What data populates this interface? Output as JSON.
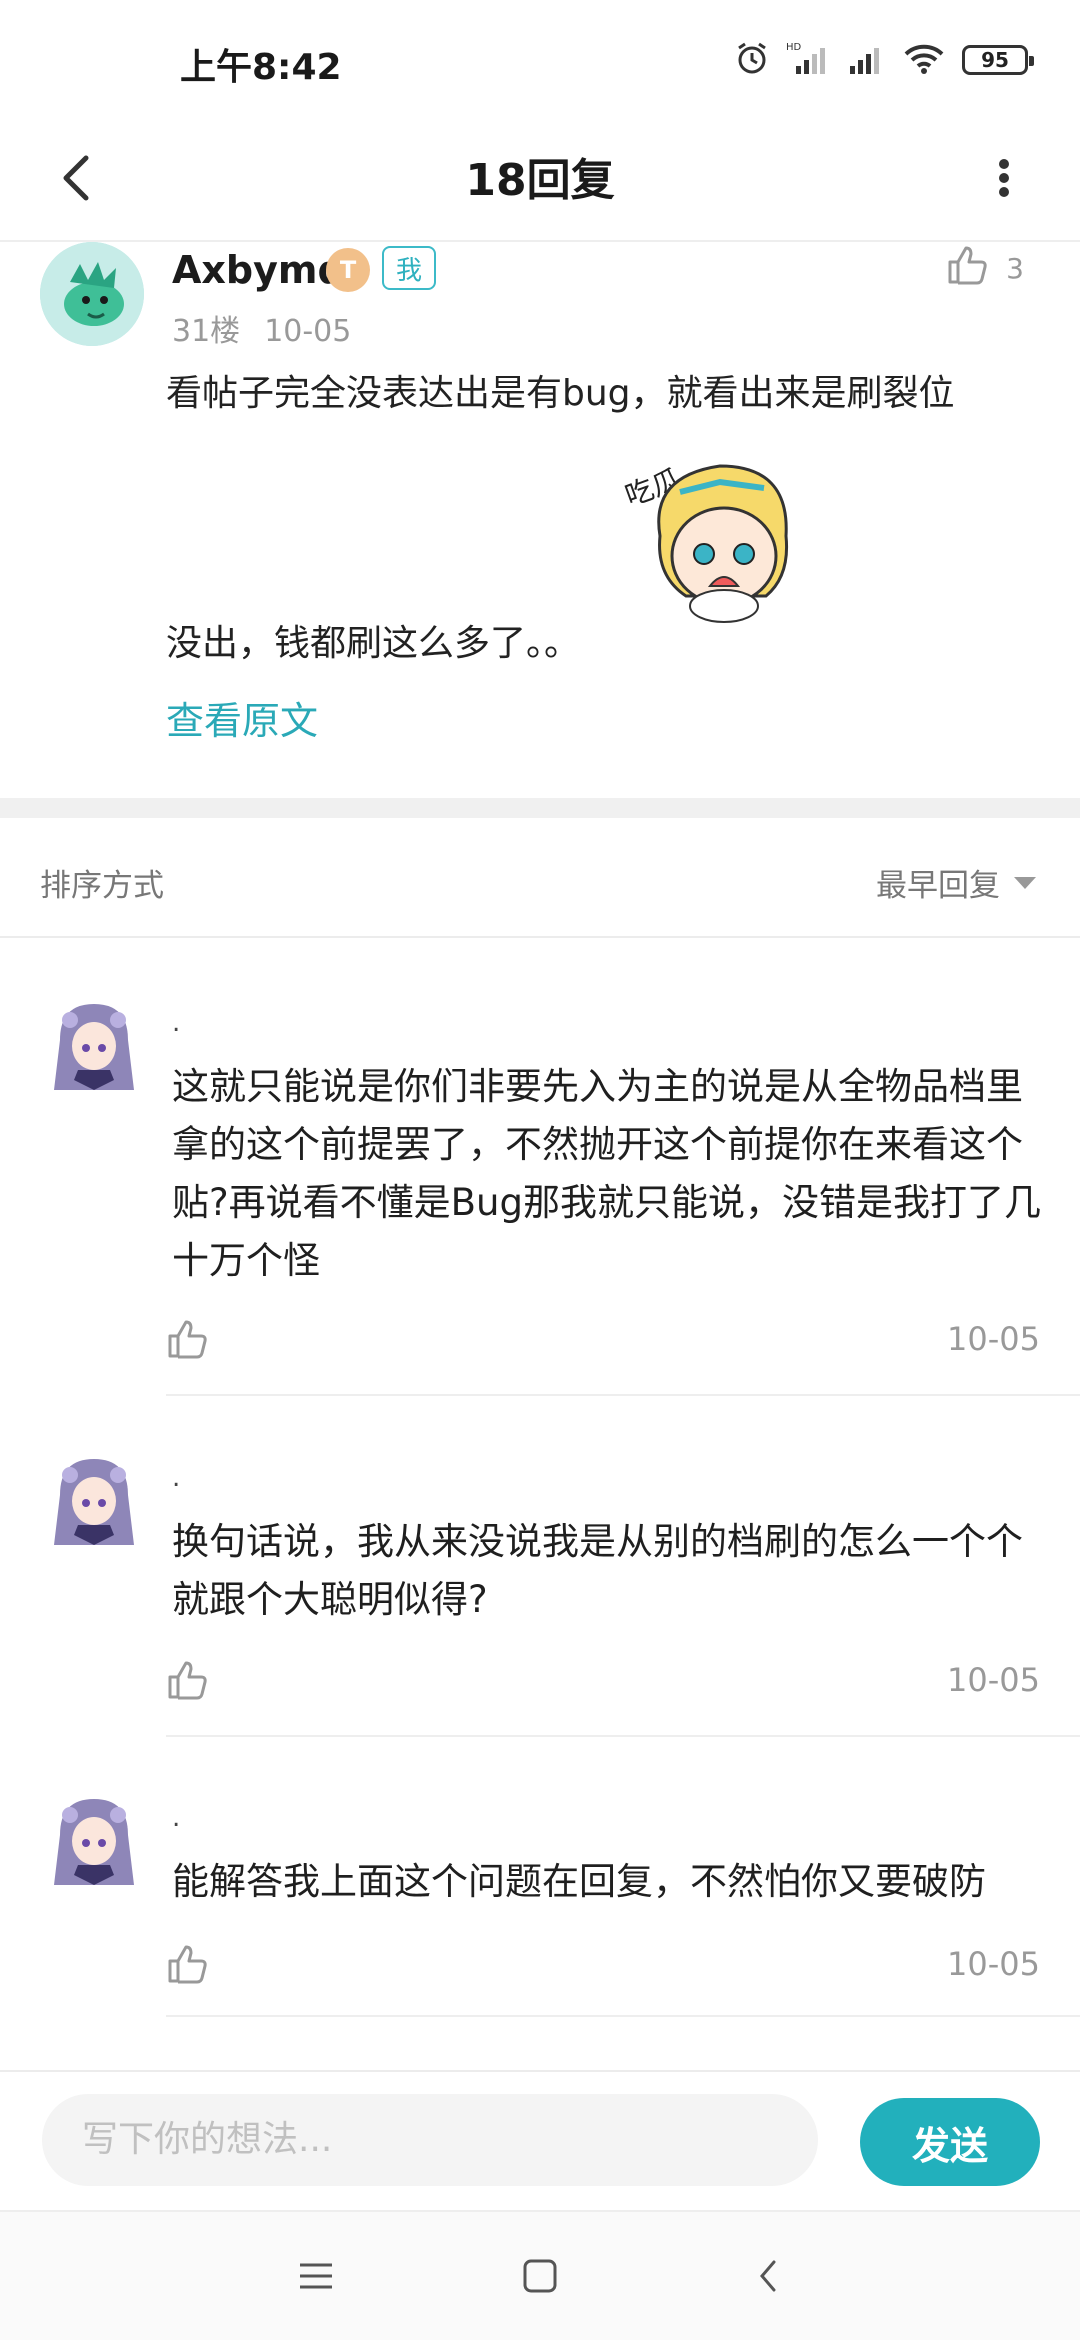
{
  "status_bar": {
    "time": "上午8:42",
    "battery": "95",
    "icons": [
      "alarm-icon",
      "hd-signal-icon",
      "signal-icon",
      "wifi-icon",
      "battery-icon"
    ]
  },
  "header": {
    "title": "18回复",
    "icons": [
      "back-arrow-icon",
      "more-vertical-icon"
    ]
  },
  "post": {
    "username": "Axbymd",
    "level_badge": "T",
    "me_badge": "我",
    "floor": "31楼",
    "date": "10-05",
    "like_count": "3",
    "text_line1": "看帖子完全没表达出是有bug，就看出来是刷裂位",
    "text_line2": "没出，钱都刷这么多了。。",
    "sticker_caption": "吃瓜…",
    "view_original": "查看原文"
  },
  "sort": {
    "label": "排序方式",
    "selected": "最早回复"
  },
  "replies": [
    {
      "name": ".",
      "text": "这就只能说是你们非要先入为主的说是从全物品档里拿的这个前提罢了，不然抛开这个前提你在来看这个贴?再说看不懂是Bug那我就只能说，没错是我打了几十万个怪",
      "date": "10-05"
    },
    {
      "name": ".",
      "text": "换句话说，我从来没说我是从别的档刷的怎么一个个就跟个大聪明似得?",
      "date": "10-05"
    },
    {
      "name": ".",
      "text": "能解答我上面这个问题在回复，不然怕你又要破防",
      "date": "10-05"
    }
  ],
  "input": {
    "placeholder": "写下你的想法...",
    "send_label": "发送"
  },
  "colors": {
    "accent": "#22b0bc",
    "link": "#2aa9b7",
    "muted_text": "#999999"
  }
}
